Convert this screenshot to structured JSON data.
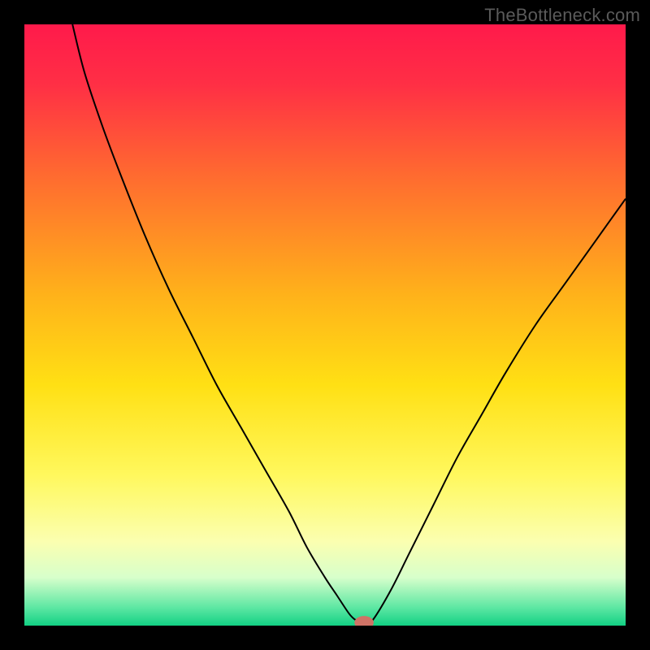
{
  "watermark": "TheBottleneck.com",
  "chart_data": {
    "type": "line",
    "title": "",
    "xlabel": "",
    "ylabel": "",
    "xlim": [
      0,
      100
    ],
    "ylim": [
      0,
      100
    ],
    "background": {
      "type": "vertical-gradient",
      "stops": [
        {
          "pos": 0.0,
          "color": "#ff1a4b"
        },
        {
          "pos": 0.1,
          "color": "#ff2f45"
        },
        {
          "pos": 0.25,
          "color": "#ff6a30"
        },
        {
          "pos": 0.45,
          "color": "#ffb21a"
        },
        {
          "pos": 0.6,
          "color": "#ffe014"
        },
        {
          "pos": 0.75,
          "color": "#fff85d"
        },
        {
          "pos": 0.86,
          "color": "#fbffb0"
        },
        {
          "pos": 0.92,
          "color": "#d7ffcb"
        },
        {
          "pos": 0.97,
          "color": "#5de7a3"
        },
        {
          "pos": 1.0,
          "color": "#12d084"
        }
      ]
    },
    "series": [
      {
        "name": "bottleneck-curve",
        "color": "#000000",
        "stroke_width": 2,
        "x": [
          8,
          10,
          13,
          16,
          20,
          24,
          28,
          32,
          36,
          40,
          44,
          47,
          50,
          52,
          54,
          55,
          56,
          57,
          58,
          61,
          64,
          68,
          72,
          76,
          80,
          85,
          90,
          95,
          100
        ],
        "y": [
          100,
          92,
          83,
          75,
          65,
          56,
          48,
          40,
          33,
          26,
          19,
          13,
          8,
          5,
          2,
          1,
          0.5,
          0.5,
          1,
          6,
          12,
          20,
          28,
          35,
          42,
          50,
          57,
          64,
          71
        ]
      }
    ],
    "marker": {
      "name": "optimal-point",
      "x": 56.5,
      "y": 0.5,
      "rx": 1.6,
      "ry": 1.1,
      "color": "#cf7366"
    }
  }
}
